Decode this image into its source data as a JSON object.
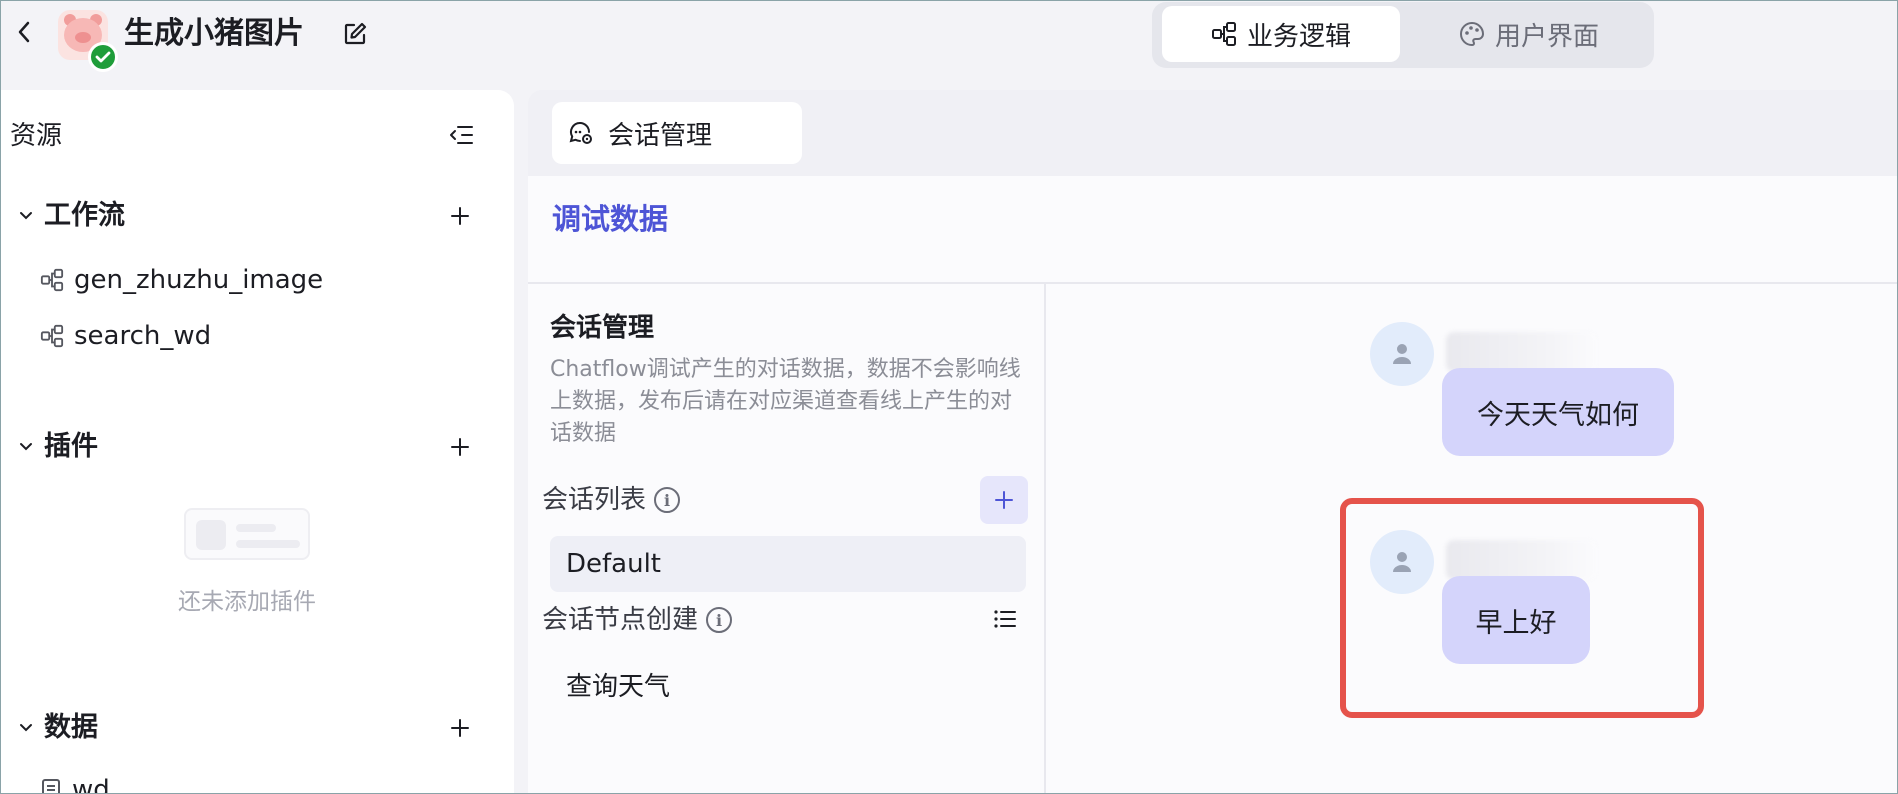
{
  "header": {
    "title": "生成小猪图片",
    "tabs": [
      {
        "label": "业务逻辑",
        "active": true
      },
      {
        "label": "用户界面",
        "active": false
      }
    ]
  },
  "sidebar": {
    "title": "资源",
    "sections": {
      "workflow": {
        "label": "工作流",
        "items": [
          "gen_zhuzhu_image",
          "search_wd"
        ]
      },
      "plugins": {
        "label": "插件",
        "empty_text": "还未添加插件"
      },
      "data": {
        "label": "数据",
        "items": [
          "wd"
        ]
      }
    }
  },
  "main": {
    "tab_label": "会话管理",
    "debug_title": "调试数据",
    "session": {
      "title": "会话管理",
      "description": "Chatflow调试产生的对话数据，数据不会影响线上数据，发布后请在对应渠道查看线上产生的对话数据",
      "list_label": "会话列表",
      "list_items": [
        "Default"
      ],
      "node_label": "会话节点创建",
      "node_items": [
        "查询天气"
      ]
    },
    "chat": {
      "messages": [
        {
          "text": "今天天气如何"
        },
        {
          "text": "早上好"
        }
      ]
    }
  },
  "colors": {
    "accent": "#4e55d6",
    "bubble": "#d4d4fb",
    "highlight": "#e5534b",
    "success": "#1f9d3a"
  }
}
